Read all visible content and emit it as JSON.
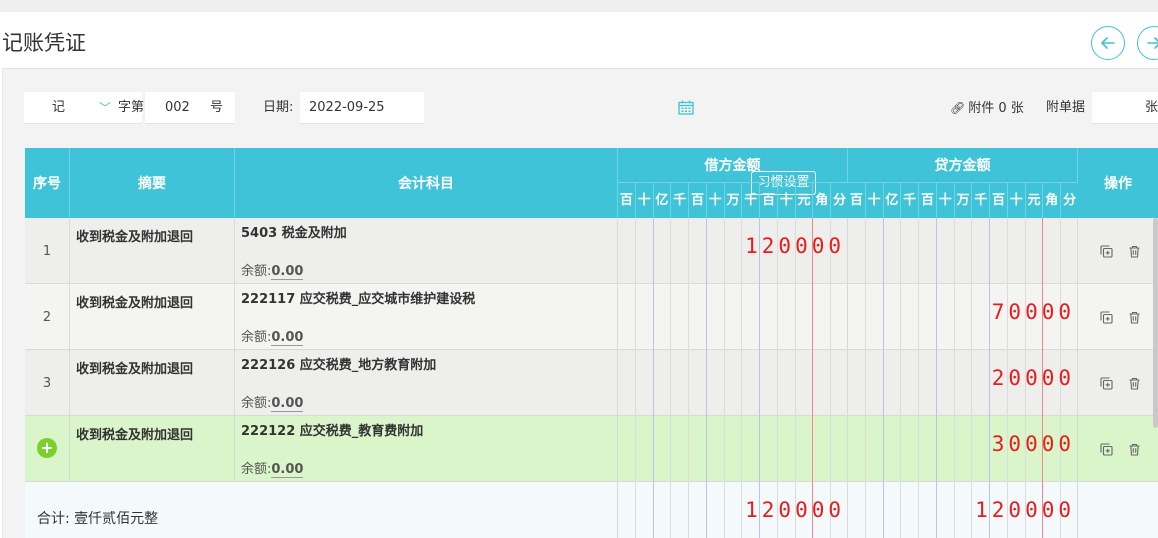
{
  "page": {
    "title": "记账凭证"
  },
  "nav": {
    "prev_icon": "arrow-left-icon",
    "next_icon": "arrow-right-icon"
  },
  "header": {
    "voucher_type": "记",
    "zi_label": "字第",
    "number": "002",
    "hao_label": "号",
    "date_label": "日期:",
    "date_value": "2022-09-25",
    "attachment_label": "附件 0 张",
    "fudan_label": "附单据",
    "fudan_unit": "张"
  },
  "table": {
    "headers": {
      "seq": "序号",
      "summary": "摘要",
      "account": "会计科目",
      "habit_button": "习惯设置",
      "debit": "借方金额",
      "credit": "贷方金额",
      "op": "操作"
    },
    "digit_units": [
      "百",
      "十",
      "亿",
      "千",
      "百",
      "十",
      "万",
      "千",
      "百",
      "十",
      "元",
      "角",
      "分"
    ],
    "balance_label": "余额:",
    "rows": [
      {
        "seq": "1",
        "summary": "收到税金及附加退回",
        "account": "5403 税金及附加",
        "balance": "0.00",
        "debit": "120000",
        "credit": ""
      },
      {
        "seq": "2",
        "summary": "收到税金及附加退回",
        "account": "222117 应交税费_应交城市维护建设税",
        "balance": "0.00",
        "debit": "",
        "credit": "70000"
      },
      {
        "seq": "3",
        "summary": "收到税金及附加退回",
        "account": "222126 应交税费_地方教育附加",
        "balance": "0.00",
        "debit": "",
        "credit": "20000"
      },
      {
        "seq": "",
        "summary": "收到税金及附加退回",
        "account": "222122 应交税费_教育费附加",
        "balance": "0.00",
        "debit": "",
        "credit": "30000"
      }
    ],
    "total": {
      "label": "合计: 壹仟贰佰元整",
      "debit": "120000",
      "credit": "120000"
    }
  },
  "colors": {
    "accent": "#3ec3d8",
    "amount": "#e81c1c",
    "add": "#7ccf2c",
    "active_row": "#d9f5c9"
  }
}
